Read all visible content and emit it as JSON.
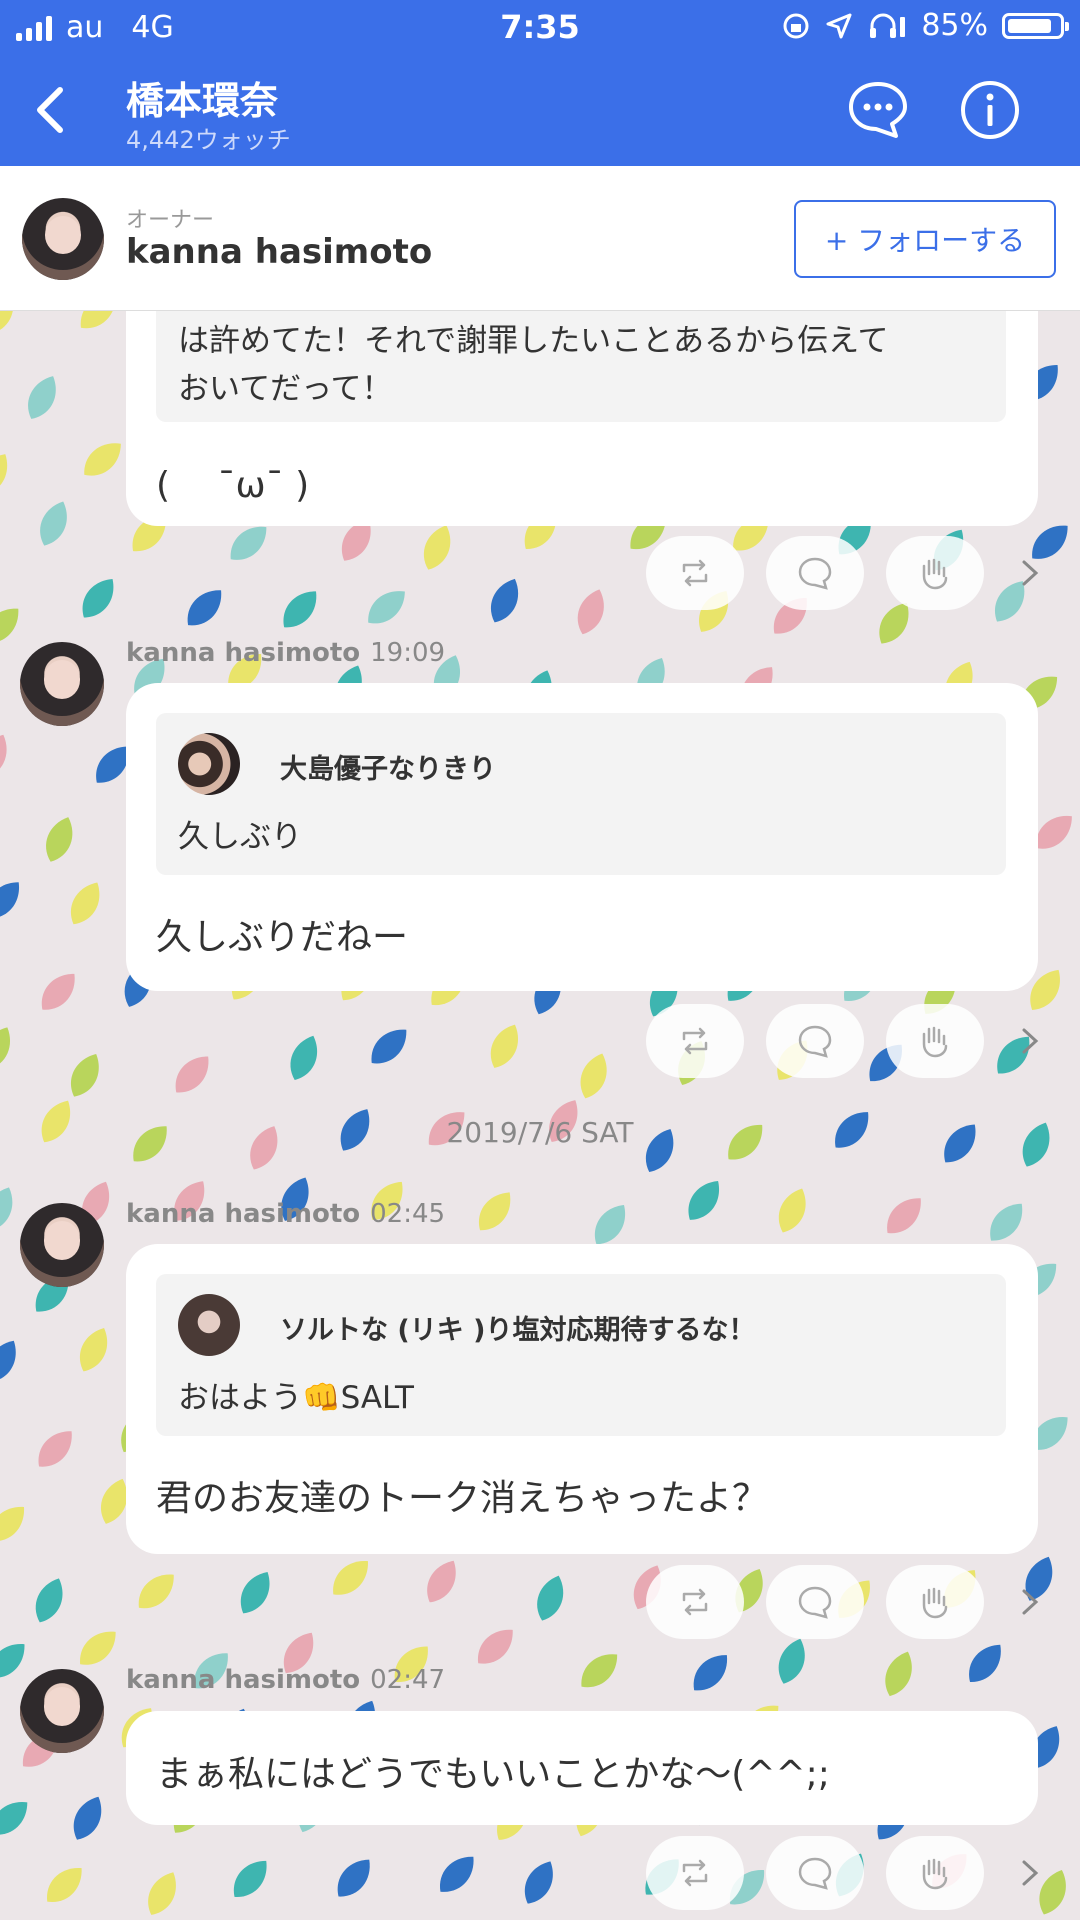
{
  "status_bar": {
    "carrier": "au",
    "network": "4G",
    "time": "7:35",
    "battery": "85%",
    "battery_level": 0.85
  },
  "header": {
    "title": "橋本環奈",
    "watch_count": "4,442ウォッチ",
    "back_icon": "chevron-left-icon",
    "chat_icon": "chat-bubble-icon",
    "info_icon": "info-icon"
  },
  "owner": {
    "role": "オーナー",
    "name": "kanna hasimoto",
    "follow_label": "+ フォローする"
  },
  "feed": {
    "first": {
      "quote_line1": "は許めてた！それで謝罪したいことあるから伝えて",
      "quote_line2": "おいてだって！",
      "text": "(　 ˉωˉ )"
    },
    "posts": [
      {
        "author": "kanna hasimoto",
        "time": "19:09",
        "quote_name": "大島優子なりきり",
        "quote_text": "久しぶり",
        "text": "久しぶりだねー"
      },
      {
        "author": "kanna hasimoto",
        "time": "02:45",
        "quote_name": "ソルトな (リキ )り塩対応期待するな！",
        "quote_text": "おはよう👊SALT",
        "text": "君のお友達のトーク消えちゃったよ？"
      },
      {
        "author": "kanna hasimoto",
        "time": "02:47",
        "text": "まぁ私にはどうでもいいことかな〜(^^;;"
      }
    ],
    "date_separator": "2019/7/6 SAT"
  },
  "actions": {
    "share_icon": "repost-icon",
    "comment_icon": "comment-icon",
    "clap_icon": "clap-hand-icon",
    "more_icon": "chevron-right-icon"
  },
  "colors": {
    "accent": "#3b6fe8",
    "background": "#ece6e8"
  }
}
